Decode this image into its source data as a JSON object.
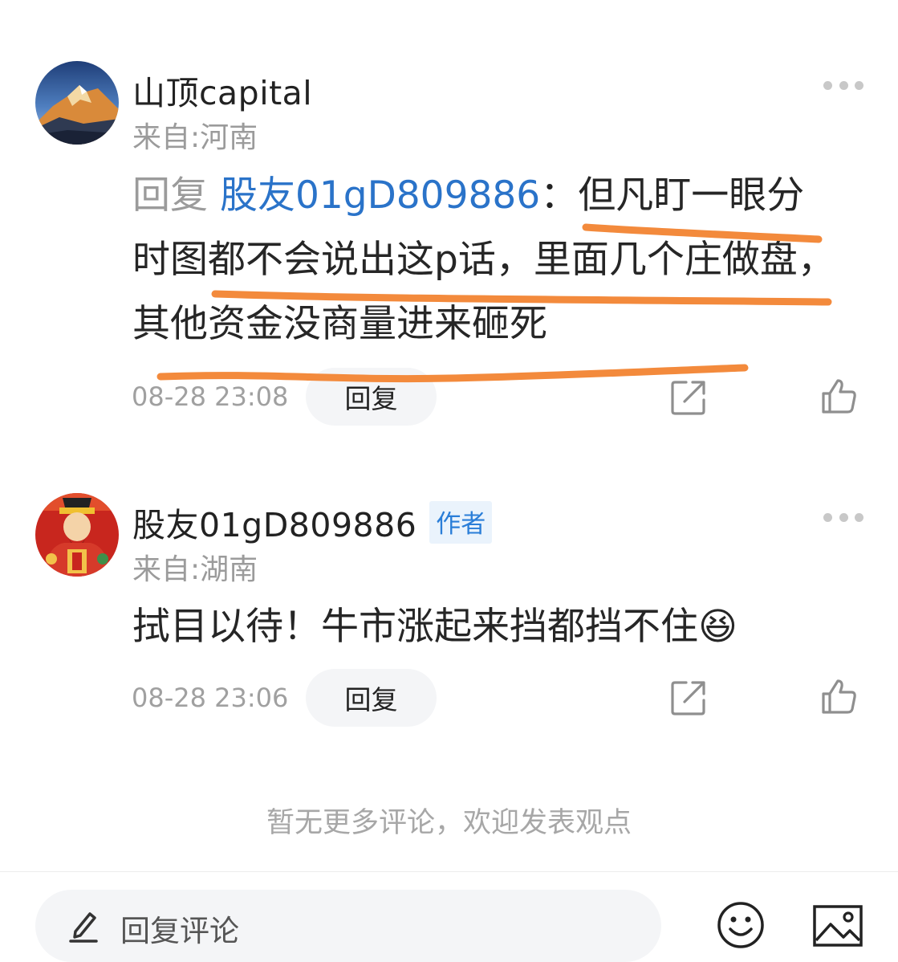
{
  "comments": [
    {
      "username": "山顶capital",
      "location": "来自:河南",
      "reply_prefix": "回复",
      "reply_target": "股友01gD809886",
      "colon": "：",
      "text": "但凡盯一眼分时图都不会说出这p话，里面几个庄做盘，其他资金没商量进来砸死",
      "timestamp": "08-28 23:08",
      "reply_label": "回复",
      "avatar_icon": "mountain-sunset-avatar"
    },
    {
      "username": "股友01gD809886",
      "author_badge": "作者",
      "location": "来自:湖南",
      "text": "拭目以待！牛市涨起来挡都挡不住",
      "emoji": "😆",
      "timestamp": "08-28 23:06",
      "reply_label": "回复",
      "avatar_icon": "god-of-wealth-avatar"
    }
  ],
  "footer": {
    "no_more_text": "暂无更多评论，欢迎发表观点",
    "input_placeholder": "回复评论"
  },
  "colors": {
    "link_blue": "#2a73c9",
    "badge_blue": "#2a7ed8",
    "badge_bg": "#eaf3fc",
    "underline_orange": "#f38a3c",
    "muted_gray": "#9b9b9b"
  }
}
